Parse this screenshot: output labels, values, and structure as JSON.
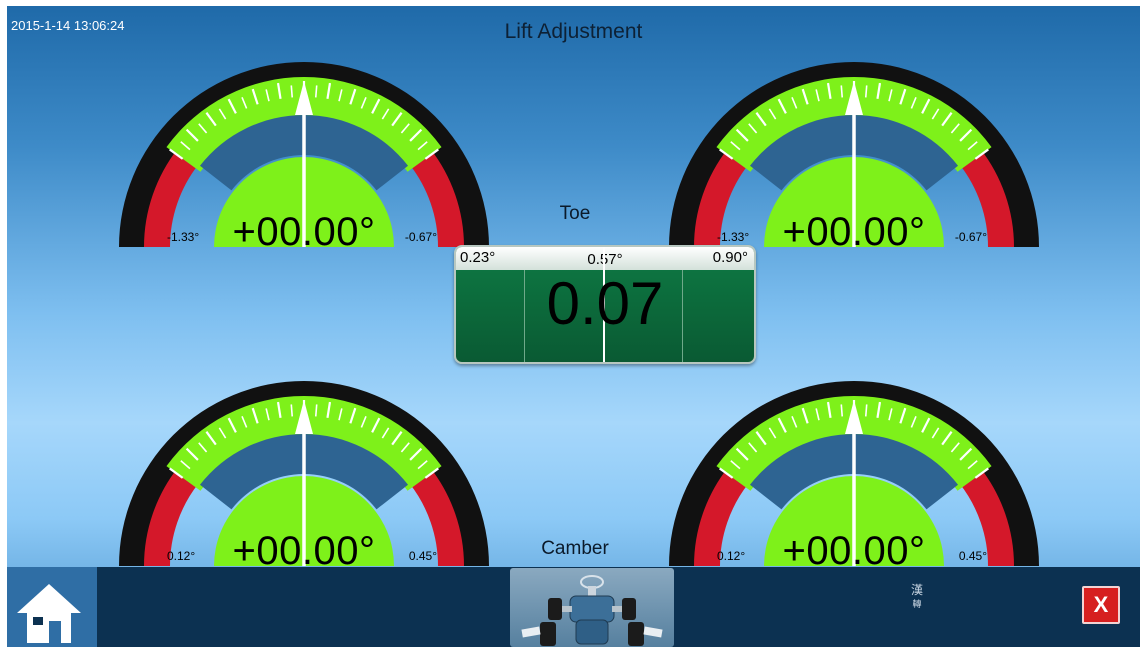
{
  "header": {
    "timestamp": "2015-1-14 13:06:24",
    "title": "Lift Adjustment"
  },
  "gauges": [
    {
      "id": "top-left",
      "value": "+00.00°",
      "min": "-1.33°",
      "max": "-0.67°",
      "needle": 0
    },
    {
      "id": "top-right",
      "value": "+00.00°",
      "min": "-1.33°",
      "max": "-0.67°",
      "needle": 0
    },
    {
      "id": "bottom-left",
      "value": "+00.00°",
      "min": "0.12°",
      "max": "0.45°",
      "needle": 0
    },
    {
      "id": "bottom-right",
      "value": "+00.00°",
      "min": "0.12°",
      "max": "0.45°",
      "needle": 0
    }
  ],
  "toe": {
    "label": "Toe",
    "min": "0.23°",
    "target": "0.57°",
    "max": "0.90°",
    "value": "0.07"
  },
  "camber": {
    "label": "Camber"
  },
  "toolbar": {
    "home_icon": "home-icon",
    "car_icon": "car-top-view-icon",
    "language_label_1": "漢",
    "language_label_2": "轉",
    "close_label": "X"
  },
  "colors": {
    "green": "#7ef11a",
    "red": "#d4182a",
    "gauge_face": "#2e6492",
    "toe_panel": "#0c6a3b",
    "close_red": "#d61f1f",
    "bottom_bar": "#0c3151",
    "home_bg": "#2f6ea5"
  }
}
